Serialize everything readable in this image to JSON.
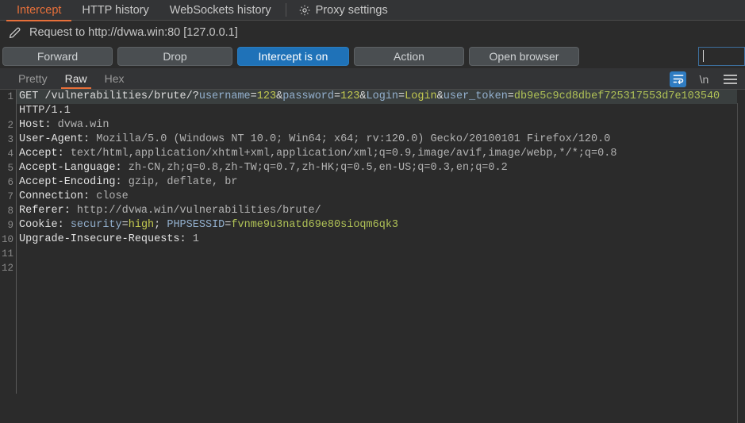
{
  "window": {
    "background": "#2b2b2b",
    "accent_orange": "#e8703a",
    "accent_blue": "#1f72b8"
  },
  "top_tabs": [
    {
      "label": "Intercept",
      "active": true
    },
    {
      "label": "HTTP history",
      "active": false
    },
    {
      "label": "WebSockets history",
      "active": false
    }
  ],
  "proxy_settings": {
    "label": "Proxy settings",
    "icon": "gear-icon"
  },
  "request_header": {
    "icon": "pencil-icon",
    "title": "Request to http://dvwa.win:80  [127.0.0.1]"
  },
  "actions": {
    "forward": "Forward",
    "drop": "Drop",
    "intercept_toggle": "Intercept is on",
    "action": "Action",
    "open_browser": "Open browser"
  },
  "search": {
    "value": "",
    "placeholder": ""
  },
  "view_tabs": [
    {
      "label": "Pretty",
      "active": false
    },
    {
      "label": "Raw",
      "active": true
    },
    {
      "label": "Hex",
      "active": false
    }
  ],
  "view_icons": [
    {
      "name": "word-wrap-icon",
      "active": true
    },
    {
      "name": "newline-icon",
      "glyph": "\\n",
      "active": false
    },
    {
      "name": "menu-icon",
      "active": false
    }
  ],
  "editor": {
    "line_numbers": [
      "1",
      "",
      "2",
      "3",
      "4",
      "5",
      "6",
      "7",
      "8",
      "9",
      "10",
      "11",
      "12"
    ],
    "lines": [
      {
        "number": "1",
        "highlighted": true,
        "segments": [
          {
            "text": "GET /vulnerabilities/brute/?",
            "style": "plain"
          },
          {
            "text": "username",
            "style": "key"
          },
          {
            "text": "=",
            "style": "plain"
          },
          {
            "text": "123",
            "style": "val"
          },
          {
            "text": "&",
            "style": "plain"
          },
          {
            "text": "password",
            "style": "key"
          },
          {
            "text": "=",
            "style": "plain"
          },
          {
            "text": "123",
            "style": "val"
          },
          {
            "text": "&",
            "style": "plain"
          },
          {
            "text": "Login",
            "style": "key"
          },
          {
            "text": "=",
            "style": "plain"
          },
          {
            "text": "Login",
            "style": "val"
          },
          {
            "text": "&",
            "style": "plain"
          },
          {
            "text": "user_token",
            "style": "key"
          },
          {
            "text": "=",
            "style": "plain"
          },
          {
            "text": "db9e5c9cd8dbef725317553d7e103540",
            "style": "token"
          }
        ]
      },
      {
        "number": "",
        "highlighted": false,
        "segments": [
          {
            "text": "HTTP/1.1",
            "style": "plain"
          }
        ]
      },
      {
        "number": "2",
        "highlighted": false,
        "segments": [
          {
            "text": "Host:",
            "style": "hdr"
          },
          {
            "text": " dvwa.win",
            "style": "dim"
          }
        ]
      },
      {
        "number": "3",
        "highlighted": false,
        "segments": [
          {
            "text": "User-Agent:",
            "style": "hdr"
          },
          {
            "text": " Mozilla/5.0 (Windows NT 10.0; Win64; x64; rv:120.0) Gecko/20100101 Firefox/120.0",
            "style": "dim"
          }
        ]
      },
      {
        "number": "4",
        "highlighted": false,
        "segments": [
          {
            "text": "Accept:",
            "style": "hdr"
          },
          {
            "text": " text/html,application/xhtml+xml,application/xml;q=0.9,image/avif,image/webp,*/*;q=0.8",
            "style": "dim"
          }
        ]
      },
      {
        "number": "5",
        "highlighted": false,
        "segments": [
          {
            "text": "Accept-Language:",
            "style": "hdr"
          },
          {
            "text": " zh-CN,zh;q=0.8,zh-TW;q=0.7,zh-HK;q=0.5,en-US;q=0.3,en;q=0.2",
            "style": "dim"
          }
        ]
      },
      {
        "number": "6",
        "highlighted": false,
        "segments": [
          {
            "text": "Accept-Encoding:",
            "style": "hdr"
          },
          {
            "text": " gzip, deflate, br",
            "style": "dim"
          }
        ]
      },
      {
        "number": "7",
        "highlighted": false,
        "segments": [
          {
            "text": "Connection:",
            "style": "hdr"
          },
          {
            "text": " close",
            "style": "dim"
          }
        ]
      },
      {
        "number": "8",
        "highlighted": false,
        "segments": [
          {
            "text": "Referer:",
            "style": "hdr"
          },
          {
            "text": " http://dvwa.win/vulnerabilities/brute/",
            "style": "dim"
          }
        ]
      },
      {
        "number": "9",
        "highlighted": false,
        "segments": [
          {
            "text": "Cookie:",
            "style": "hdr"
          },
          {
            "text": " ",
            "style": "plain"
          },
          {
            "text": "security",
            "style": "key"
          },
          {
            "text": "=",
            "style": "plain"
          },
          {
            "text": "high",
            "style": "val"
          },
          {
            "text": "; ",
            "style": "plain"
          },
          {
            "text": "PHPSESSID",
            "style": "key"
          },
          {
            "text": "=",
            "style": "plain"
          },
          {
            "text": "fvnme9u3natd69e80sioqm6qk3",
            "style": "token"
          }
        ]
      },
      {
        "number": "10",
        "highlighted": false,
        "segments": [
          {
            "text": "Upgrade-Insecure-Requests:",
            "style": "hdr"
          },
          {
            "text": " 1",
            "style": "dim"
          }
        ]
      },
      {
        "number": "11",
        "highlighted": false,
        "segments": []
      },
      {
        "number": "12",
        "highlighted": false,
        "segments": []
      }
    ]
  }
}
